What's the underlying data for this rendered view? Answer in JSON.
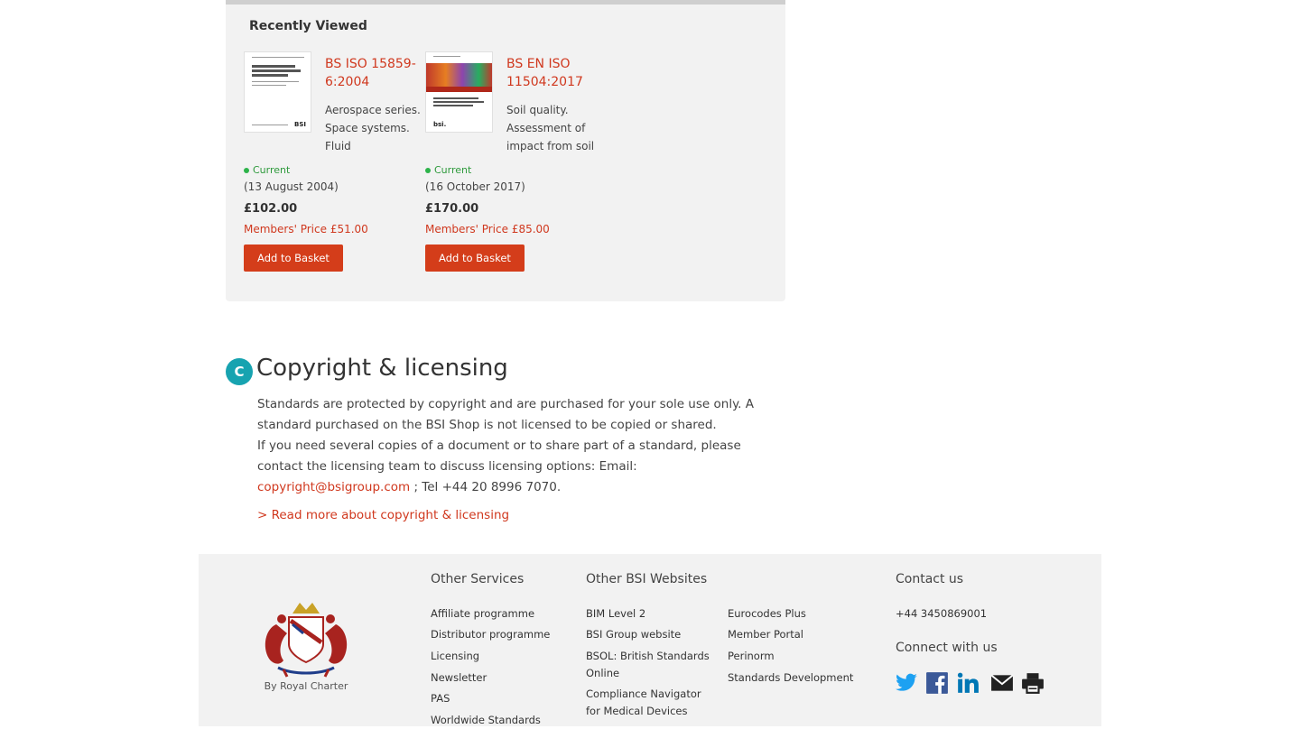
{
  "recently_viewed": {
    "title": "Recently Viewed",
    "products": [
      {
        "code": "BS ISO 15859-6:2004",
        "description": "Aerospace series. Space systems. Fluid",
        "status": "Current",
        "date": "(13 August 2004)",
        "price": "£102.00",
        "members_price": "Members' Price £51.00",
        "button": "Add to Basket"
      },
      {
        "code": "BS EN ISO 11504:2017",
        "description": "Soil quality. Assessment of impact from soil",
        "status": "Current",
        "date": "(16 October 2017)",
        "price": "£170.00",
        "members_price": "Members' Price £85.00",
        "button": "Add to Basket"
      }
    ]
  },
  "copyright": {
    "icon_letter": "C",
    "heading": "Copyright & licensing",
    "para1": "Standards are protected by copyright and are purchased for your sole use only. A standard purchased on the BSI Shop is not licensed to be copied or shared.",
    "para2_prefix": "If you need several copies of a document or to share part of a standard, please contact the licensing team to discuss licensing options: Email: ",
    "email": "copyright@bsigroup.com",
    "para2_suffix": " ; Tel +44 20 8996 7070.",
    "read_more": "> Read more about copyright & licensing"
  },
  "footer": {
    "crest_caption": "By Royal Charter",
    "other_services": {
      "title": "Other Services",
      "links": [
        "Affiliate programme",
        "Distributor programme",
        "Licensing",
        "Newsletter",
        "PAS",
        "Worldwide Standards"
      ]
    },
    "other_websites": {
      "title": "Other BSI Websites",
      "col1": [
        "BIM Level 2",
        "BSI Group website",
        "BSOL: British Standards Online",
        "Compliance Navigator for Medical Devices"
      ],
      "col2": [
        "Eurocodes Plus",
        "Member Portal",
        "Perinorm",
        "Standards Development"
      ]
    },
    "contact": {
      "title": "Contact us",
      "phone": "+44 3450869001",
      "connect_title": "Connect with us",
      "social": [
        "twitter-icon",
        "facebook-icon",
        "linkedin-icon",
        "email-icon",
        "print-icon"
      ]
    }
  },
  "colors": {
    "accent_red": "#d0381e",
    "button_red": "#d43d1a",
    "status_green": "#2db34a",
    "teal": "#17a3b0",
    "panel_bg": "#f2f2f2"
  }
}
